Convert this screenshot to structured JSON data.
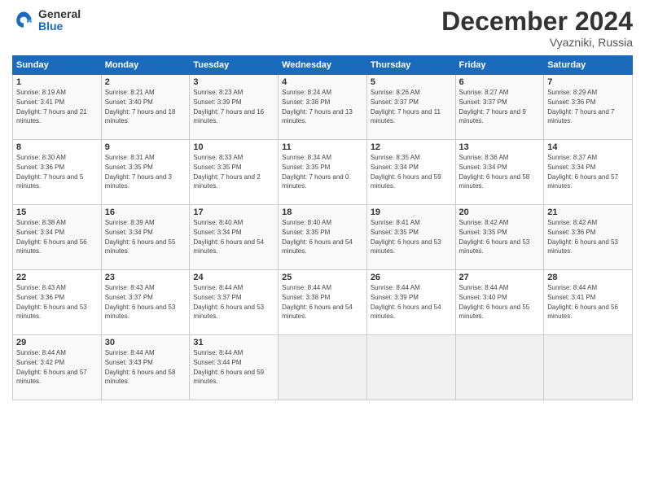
{
  "header": {
    "logo_general": "General",
    "logo_blue": "Blue",
    "title": "December 2024",
    "location": "Vyazniki, Russia"
  },
  "days_of_week": [
    "Sunday",
    "Monday",
    "Tuesday",
    "Wednesday",
    "Thursday",
    "Friday",
    "Saturday"
  ],
  "weeks": [
    [
      {
        "day": 1,
        "rise": "8:19 AM",
        "set": "3:41 PM",
        "daylight": "7 hours and 21 minutes."
      },
      {
        "day": 2,
        "rise": "8:21 AM",
        "set": "3:40 PM",
        "daylight": "7 hours and 18 minutes."
      },
      {
        "day": 3,
        "rise": "8:23 AM",
        "set": "3:39 PM",
        "daylight": "7 hours and 16 minutes."
      },
      {
        "day": 4,
        "rise": "8:24 AM",
        "set": "3:38 PM",
        "daylight": "7 hours and 13 minutes."
      },
      {
        "day": 5,
        "rise": "8:26 AM",
        "set": "3:37 PM",
        "daylight": "7 hours and 11 minutes."
      },
      {
        "day": 6,
        "rise": "8:27 AM",
        "set": "3:37 PM",
        "daylight": "7 hours and 9 minutes."
      },
      {
        "day": 7,
        "rise": "8:29 AM",
        "set": "3:36 PM",
        "daylight": "7 hours and 7 minutes."
      }
    ],
    [
      {
        "day": 8,
        "rise": "8:30 AM",
        "set": "3:36 PM",
        "daylight": "7 hours and 5 minutes."
      },
      {
        "day": 9,
        "rise": "8:31 AM",
        "set": "3:35 PM",
        "daylight": "7 hours and 3 minutes."
      },
      {
        "day": 10,
        "rise": "8:33 AM",
        "set": "3:35 PM",
        "daylight": "7 hours and 2 minutes."
      },
      {
        "day": 11,
        "rise": "8:34 AM",
        "set": "3:35 PM",
        "daylight": "7 hours and 0 minutes."
      },
      {
        "day": 12,
        "rise": "8:35 AM",
        "set": "3:34 PM",
        "daylight": "6 hours and 59 minutes."
      },
      {
        "day": 13,
        "rise": "8:36 AM",
        "set": "3:34 PM",
        "daylight": "6 hours and 58 minutes."
      },
      {
        "day": 14,
        "rise": "8:37 AM",
        "set": "3:34 PM",
        "daylight": "6 hours and 57 minutes."
      }
    ],
    [
      {
        "day": 15,
        "rise": "8:38 AM",
        "set": "3:34 PM",
        "daylight": "6 hours and 56 minutes."
      },
      {
        "day": 16,
        "rise": "8:39 AM",
        "set": "3:34 PM",
        "daylight": "6 hours and 55 minutes."
      },
      {
        "day": 17,
        "rise": "8:40 AM",
        "set": "3:34 PM",
        "daylight": "6 hours and 54 minutes."
      },
      {
        "day": 18,
        "rise": "8:40 AM",
        "set": "3:35 PM",
        "daylight": "6 hours and 54 minutes."
      },
      {
        "day": 19,
        "rise": "8:41 AM",
        "set": "3:35 PM",
        "daylight": "6 hours and 53 minutes."
      },
      {
        "day": 20,
        "rise": "8:42 AM",
        "set": "3:35 PM",
        "daylight": "6 hours and 53 minutes."
      },
      {
        "day": 21,
        "rise": "8:42 AM",
        "set": "3:36 PM",
        "daylight": "6 hours and 53 minutes."
      }
    ],
    [
      {
        "day": 22,
        "rise": "8:43 AM",
        "set": "3:36 PM",
        "daylight": "6 hours and 53 minutes."
      },
      {
        "day": 23,
        "rise": "8:43 AM",
        "set": "3:37 PM",
        "daylight": "6 hours and 53 minutes."
      },
      {
        "day": 24,
        "rise": "8:44 AM",
        "set": "3:37 PM",
        "daylight": "6 hours and 53 minutes."
      },
      {
        "day": 25,
        "rise": "8:44 AM",
        "set": "3:38 PM",
        "daylight": "6 hours and 54 minutes."
      },
      {
        "day": 26,
        "rise": "8:44 AM",
        "set": "3:39 PM",
        "daylight": "6 hours and 54 minutes."
      },
      {
        "day": 27,
        "rise": "8:44 AM",
        "set": "3:40 PM",
        "daylight": "6 hours and 55 minutes."
      },
      {
        "day": 28,
        "rise": "8:44 AM",
        "set": "3:41 PM",
        "daylight": "6 hours and 56 minutes."
      }
    ],
    [
      {
        "day": 29,
        "rise": "8:44 AM",
        "set": "3:42 PM",
        "daylight": "6 hours and 57 minutes."
      },
      {
        "day": 30,
        "rise": "8:44 AM",
        "set": "3:43 PM",
        "daylight": "6 hours and 58 minutes."
      },
      {
        "day": 31,
        "rise": "8:44 AM",
        "set": "3:44 PM",
        "daylight": "6 hours and 59 minutes."
      },
      null,
      null,
      null,
      null
    ]
  ]
}
